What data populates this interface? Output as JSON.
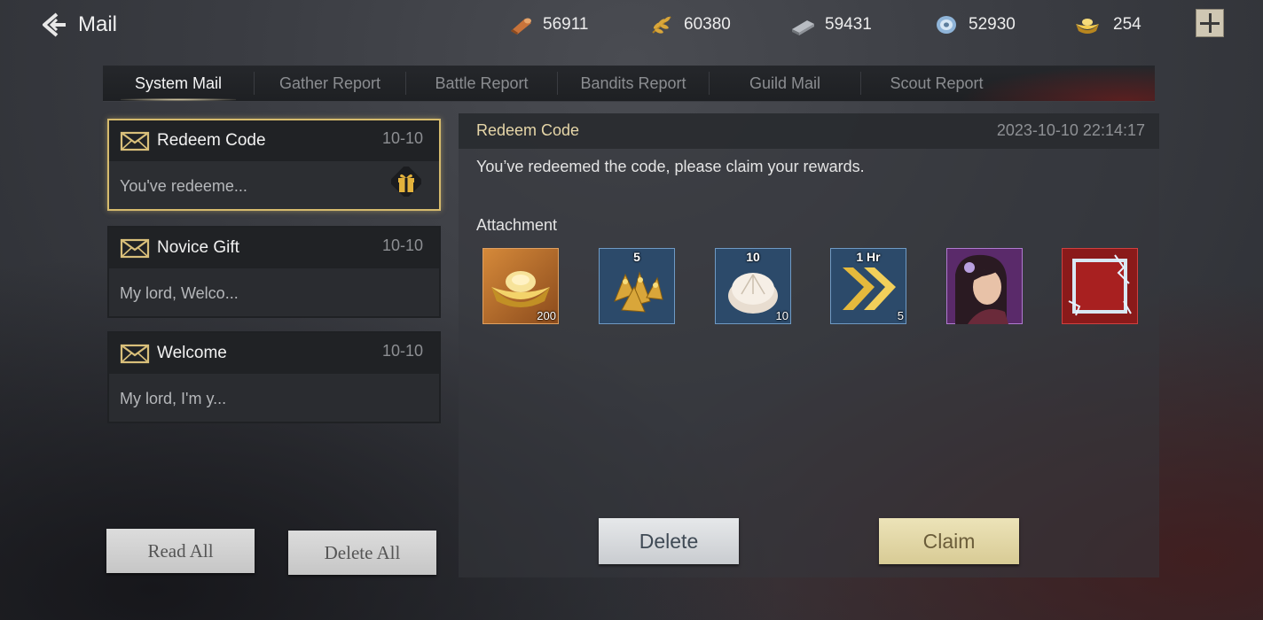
{
  "header": {
    "title": "Mail",
    "back_icon": "back-arrow-icon",
    "plus_icon": "plus-icon"
  },
  "resources": [
    {
      "name": "wood-icon",
      "value": "56911",
      "color": "#c8733a"
    },
    {
      "name": "grain-icon",
      "value": "60380",
      "color": "#d9a63a"
    },
    {
      "name": "iron-icon",
      "value": "59431",
      "color": "#b8bcc2"
    },
    {
      "name": "silver-icon",
      "value": "52930",
      "color": "#8fb4d8"
    },
    {
      "name": "gold-ingot-icon",
      "value": "254",
      "color": "#e5bf4a"
    }
  ],
  "tabs": [
    {
      "label": "System Mail",
      "active": true
    },
    {
      "label": "Gather Report"
    },
    {
      "label": "Battle Report"
    },
    {
      "label": "Bandits Report"
    },
    {
      "label": "Guild Mail"
    },
    {
      "label": "Scout Report"
    }
  ],
  "mails": [
    {
      "title": "Redeem Code",
      "date": "10-10",
      "preview": "You've redeeme...",
      "icon": "envelope-icon",
      "badge": "gift-icon",
      "selected": true
    },
    {
      "title": "Novice Gift",
      "date": "10-10",
      "preview": "My lord, Welco...",
      "icon": "envelope-icon"
    },
    {
      "title": "Welcome",
      "date": "10-10",
      "preview": "My lord, I'm y...",
      "icon": "envelope-icon"
    }
  ],
  "list_actions": {
    "read_all": "Read All",
    "delete_all": "Delete All"
  },
  "detail": {
    "title": "Redeem Code",
    "timestamp": "2023-10-10 22:14:17",
    "body": "You’ve redeemed the code, please claim your rewards.",
    "attachment_label": "Attachment",
    "attachments": [
      {
        "name": "gold-ingot-item-icon",
        "top": "",
        "qty": "200"
      },
      {
        "name": "gold-badges-item-icon",
        "top": "5",
        "qty": ""
      },
      {
        "name": "steamed-bun-item-icon",
        "top": "10",
        "qty": "10"
      },
      {
        "name": "speedup-item-icon",
        "top": "1 Hr",
        "qty": "5"
      },
      {
        "name": "hero-portrait-item-icon",
        "top": "",
        "qty": ""
      },
      {
        "name": "avatar-frame-item-icon",
        "top": "",
        "qty": ""
      }
    ],
    "delete_label": "Delete",
    "claim_label": "Claim"
  }
}
